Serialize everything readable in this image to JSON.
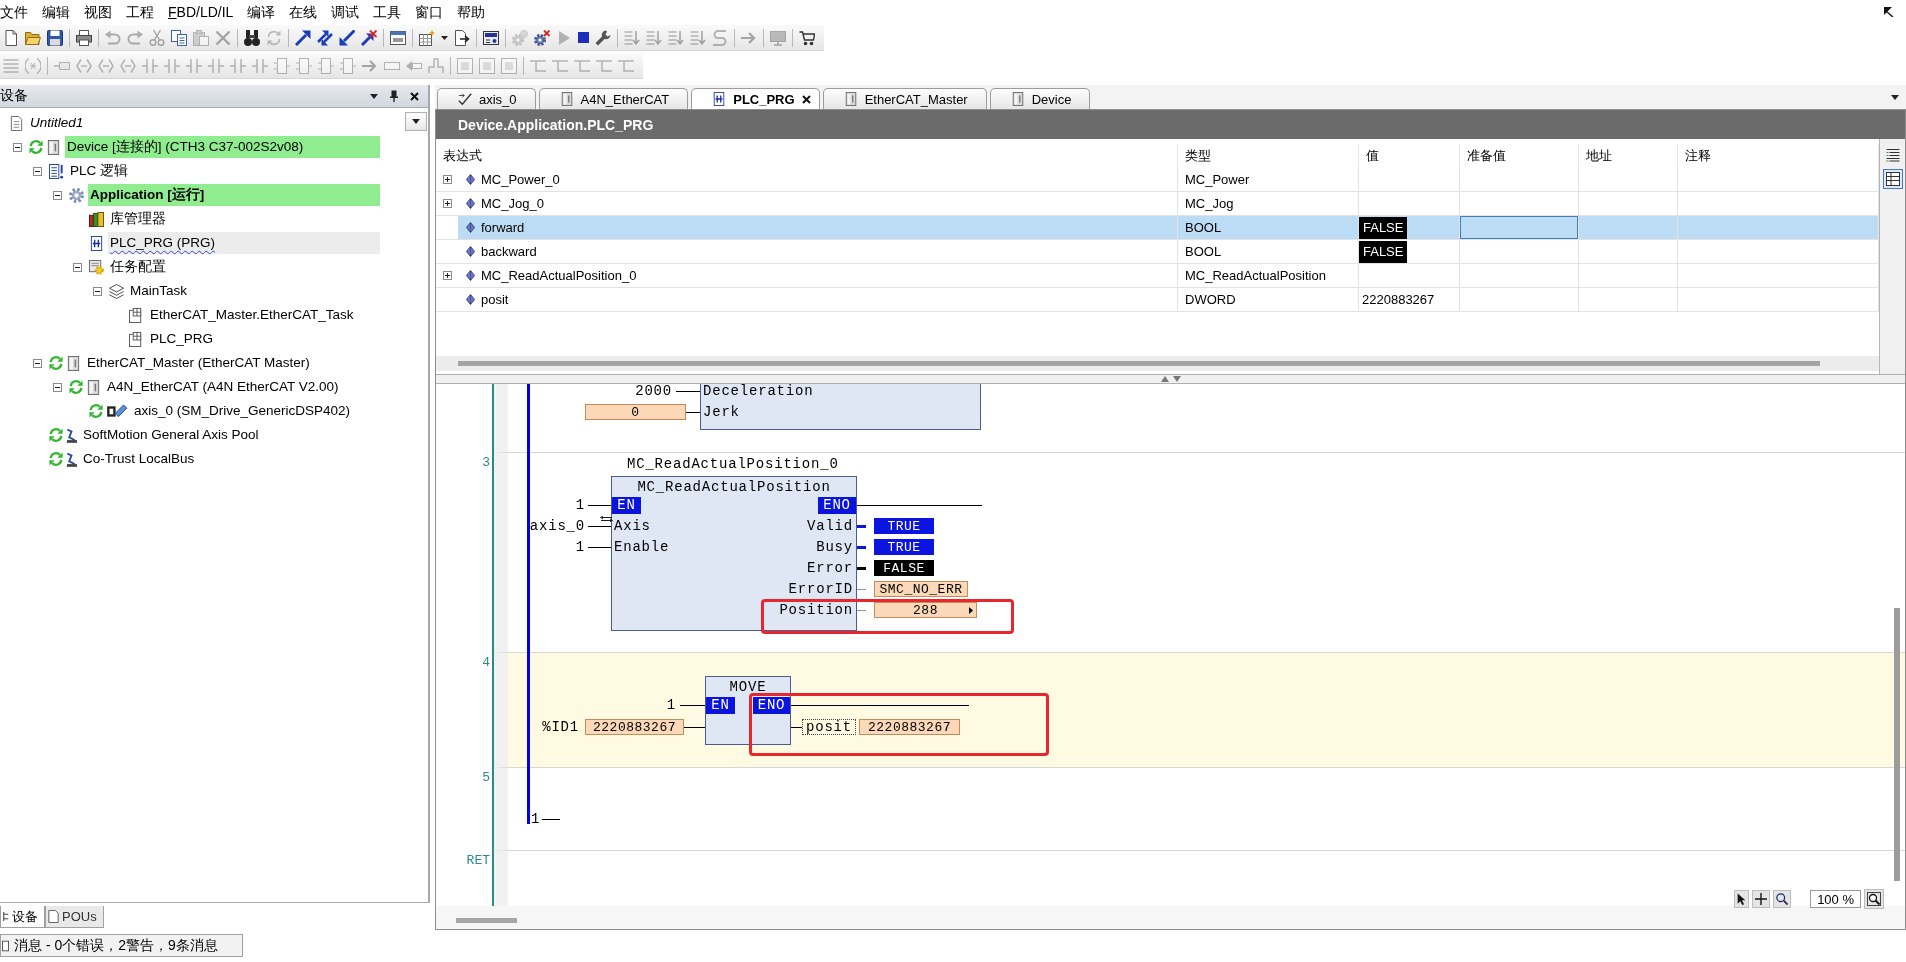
{
  "menu": [
    {
      "label": "文件",
      "mnemonic": false
    },
    {
      "label": "编辑",
      "mnemonic": false
    },
    {
      "label": "视图",
      "mnemonic": false
    },
    {
      "label": "工程",
      "mnemonic": false
    },
    {
      "label": "FBD/LD/IL",
      "mnemonic": true
    },
    {
      "label": "编译",
      "mnemonic": false
    },
    {
      "label": "在线",
      "mnemonic": false
    },
    {
      "label": "调试",
      "mnemonic": false
    },
    {
      "label": "工具",
      "mnemonic": false
    },
    {
      "label": "窗口",
      "mnemonic": false
    },
    {
      "label": "帮助",
      "mnemonic": false
    }
  ],
  "toolbar_main": [
    {
      "kind": "new",
      "disabled": false
    },
    {
      "kind": "open",
      "disabled": false
    },
    {
      "kind": "save",
      "disabled": false
    },
    {
      "kind": "separator"
    },
    {
      "kind": "print",
      "disabled": false
    },
    {
      "kind": "separator"
    },
    {
      "kind": "undo",
      "disabled": true
    },
    {
      "kind": "redo",
      "disabled": true
    },
    {
      "kind": "cut",
      "disabled": true
    },
    {
      "kind": "copy",
      "disabled": false
    },
    {
      "kind": "paste",
      "disabled": true
    },
    {
      "kind": "delete",
      "disabled": true
    },
    {
      "kind": "separator"
    },
    {
      "kind": "find",
      "disabled": false
    },
    {
      "kind": "replace",
      "disabled": true
    },
    {
      "kind": "separator"
    },
    {
      "kind": "login",
      "disabled": false
    },
    {
      "kind": "logout",
      "disabled": false
    },
    {
      "kind": "download",
      "disabled": false
    },
    {
      "kind": "reset",
      "disabled": false
    },
    {
      "kind": "separator"
    },
    {
      "kind": "window",
      "disabled": false
    },
    {
      "kind": "separator"
    },
    {
      "kind": "build",
      "disabled": false
    },
    {
      "kind": "caret",
      "disabled": false
    },
    {
      "kind": "export",
      "disabled": false
    },
    {
      "kind": "separator"
    },
    {
      "kind": "visualization",
      "disabled": false
    },
    {
      "kind": "separator"
    },
    {
      "kind": "start-gear",
      "disabled": true
    },
    {
      "kind": "stop-gear",
      "disabled": false
    },
    {
      "kind": "run",
      "disabled": true
    },
    {
      "kind": "stop",
      "disabled": false
    },
    {
      "kind": "wrench",
      "disabled": false
    },
    {
      "kind": "separator"
    },
    {
      "kind": "step",
      "disabled": true
    },
    {
      "kind": "step",
      "disabled": true
    },
    {
      "kind": "step",
      "disabled": true
    },
    {
      "kind": "step",
      "disabled": true
    },
    {
      "kind": "cycle",
      "disabled": true
    },
    {
      "kind": "separator"
    },
    {
      "kind": "arrow",
      "disabled": true
    },
    {
      "kind": "separator"
    },
    {
      "kind": "screen",
      "disabled": true
    },
    {
      "kind": "separator"
    },
    {
      "kind": "cart",
      "disabled": false
    }
  ],
  "toolbar_fbd": [
    {
      "kind": "list",
      "disabled": true
    },
    {
      "kind": "comment",
      "disabled": true
    },
    {
      "kind": "separator"
    },
    {
      "kind": "variable",
      "disabled": true
    },
    {
      "kind": "network",
      "disabled": true
    },
    {
      "kind": "network",
      "disabled": true
    },
    {
      "kind": "network",
      "disabled": true
    },
    {
      "kind": "contact",
      "disabled": true
    },
    {
      "kind": "contact",
      "disabled": true
    },
    {
      "kind": "contact",
      "disabled": true
    },
    {
      "kind": "contact",
      "disabled": true
    },
    {
      "kind": "contact",
      "disabled": true
    },
    {
      "kind": "contact",
      "disabled": true
    },
    {
      "kind": "box",
      "disabled": true
    },
    {
      "kind": "box",
      "disabled": true
    },
    {
      "kind": "box",
      "disabled": true
    },
    {
      "kind": "box",
      "disabled": true
    },
    {
      "kind": "arrow",
      "disabled": true
    },
    {
      "kind": "label",
      "disabled": true
    },
    {
      "kind": "return",
      "disabled": true
    },
    {
      "kind": "edge",
      "disabled": true
    },
    {
      "kind": "separator"
    },
    {
      "kind": "square",
      "disabled": true
    },
    {
      "kind": "square",
      "disabled": true
    },
    {
      "kind": "square",
      "disabled": true
    },
    {
      "kind": "separator"
    },
    {
      "kind": "branch",
      "disabled": true
    },
    {
      "kind": "branch",
      "disabled": true
    },
    {
      "kind": "branch",
      "disabled": true
    },
    {
      "kind": "branch",
      "disabled": true
    },
    {
      "kind": "branch",
      "disabled": true
    }
  ],
  "devices_panel": {
    "title": "设备",
    "tree": [
      {
        "label": "Untitled1",
        "kind": "project",
        "connected": false,
        "highlighted": false,
        "selected": false,
        "children": [
          {
            "label": "Device [连接的] (CTH3 C37-002S2v08)",
            "kind": "device",
            "expanded": true,
            "connected": true,
            "highlighted": true,
            "selected": false,
            "children": [
              {
                "label": "PLC 逻辑",
                "kind": "plc-logic",
                "expanded": true,
                "connected": false,
                "highlighted": false,
                "selected": false,
                "children": [
                  {
                    "label": "Application [运行]",
                    "kind": "application",
                    "expanded": true,
                    "connected": false,
                    "highlighted": true,
                    "selected": false,
                    "children": [
                      {
                        "label": "库管理器",
                        "kind": "library",
                        "connected": false,
                        "highlighted": false,
                        "selected": false
                      },
                      {
                        "label": "PLC_PRG (PRG)",
                        "kind": "pou",
                        "connected": false,
                        "highlighted": false,
                        "selected": true
                      },
                      {
                        "label": "任务配置",
                        "kind": "task-config",
                        "expanded": true,
                        "connected": false,
                        "highlighted": false,
                        "selected": false,
                        "children": [
                          {
                            "label": "MainTask",
                            "kind": "task",
                            "expanded": true,
                            "connected": false,
                            "highlighted": false,
                            "selected": false,
                            "children": [
                              {
                                "label": "EtherCAT_Master.EtherCAT_Task",
                                "kind": "task-call",
                                "connected": false,
                                "highlighted": false,
                                "selected": false
                              },
                              {
                                "label": "PLC_PRG",
                                "kind": "task-call",
                                "connected": false,
                                "highlighted": false,
                                "selected": false
                              }
                            ]
                          }
                        ]
                      }
                    ]
                  }
                ]
              },
              {
                "label": "EtherCAT_Master (EtherCAT Master)",
                "kind": "device",
                "expanded": true,
                "connected": true,
                "highlighted": false,
                "selected": false,
                "children": [
                  {
                    "label": "A4N_EtherCAT (A4N EtherCAT V2.00)",
                    "kind": "device",
                    "expanded": true,
                    "connected": true,
                    "highlighted": false,
                    "selected": false,
                    "children": [
                      {
                        "label": "axis_0 (SM_Drive_GenericDSP402)",
                        "kind": "axis",
                        "connected": true,
                        "highlighted": false,
                        "selected": false
                      }
                    ]
                  }
                ]
              },
              {
                "label": "SoftMotion General Axis Pool",
                "kind": "axis-pool",
                "connected": true,
                "highlighted": false,
                "selected": false
              },
              {
                "label": "Co-Trust LocalBus",
                "kind": "axis-pool",
                "connected": true,
                "highlighted": false,
                "selected": false
              }
            ]
          }
        ]
      }
    ],
    "tabs": [
      {
        "label": "设备",
        "selected": true
      },
      {
        "label": "POUs",
        "selected": false
      }
    ]
  },
  "editor": {
    "tabs": [
      {
        "label": "axis_0",
        "kind": "axis",
        "selected": false
      },
      {
        "label": "A4N_EtherCAT",
        "kind": "device",
        "selected": false
      },
      {
        "label": "PLC_PRG",
        "kind": "pou",
        "selected": true
      },
      {
        "label": "EtherCAT_Master",
        "kind": "device",
        "selected": false
      },
      {
        "label": "Device",
        "kind": "device",
        "selected": false
      }
    ],
    "path": "Device.Application.PLC_PRG",
    "watch": {
      "columns": [
        "表达式",
        "类型",
        "值",
        "准备值",
        "地址",
        "注释"
      ],
      "rows": [
        {
          "expression": "MC_Power_0",
          "type": "MC_Power",
          "kind": "instance",
          "expanded": false,
          "selected": false,
          "focused": false
        },
        {
          "expression": "MC_Jog_0",
          "type": "MC_Jog",
          "kind": "instance",
          "expanded": false,
          "selected": false,
          "focused": false
        },
        {
          "expression": "forward",
          "type": "BOOL",
          "value": "FALSE",
          "kind": "bool",
          "selected": true,
          "focused": true
        },
        {
          "expression": "backward",
          "type": "BOOL",
          "value": "FALSE",
          "kind": "bool",
          "selected": false,
          "focused": false
        },
        {
          "expression": "MC_ReadActualPosition_0",
          "type": "MC_ReadActualPosition",
          "kind": "instance",
          "expanded": false,
          "selected": false,
          "focused": false
        },
        {
          "expression": "posit",
          "type": "DWORD",
          "value": "2220883267",
          "kind": "number",
          "selected": false,
          "focused": false
        }
      ],
      "view_buttons": [
        {
          "kind": "list",
          "selected": false
        },
        {
          "kind": "table",
          "selected": true
        }
      ]
    },
    "fbd": {
      "networks": [
        {
          "kind": "block-tail",
          "selected": false,
          "inputs": [
            {
              "kind": "constant",
              "source": "2000",
              "pin": "Deceleration"
            },
            {
              "kind": "online",
              "source": "0",
              "pin": "Jerk"
            }
          ]
        },
        {
          "kind": "block",
          "number": "3",
          "selected": false,
          "instance": "MC_ReadActualPosition_0",
          "block": "MC_ReadActualPosition",
          "enable_in": {
            "source": "1",
            "pin": "EN"
          },
          "enable_out": {
            "pin": "ENO"
          },
          "inputs": [
            {
              "kind": "inout",
              "source": "axis_0",
              "pin": "Axis"
            },
            {
              "kind": "constant",
              "source": "1",
              "pin": "Enable"
            }
          ],
          "outputs": [
            {
              "pin": "Valid",
              "kind": "true",
              "value": "TRUE",
              "expandable": false,
              "annotated": false
            },
            {
              "pin": "Busy",
              "kind": "true",
              "value": "TRUE",
              "expandable": false,
              "annotated": false
            },
            {
              "pin": "Error",
              "kind": "false",
              "value": "FALSE",
              "expandable": false,
              "annotated": false
            },
            {
              "pin": "ErrorID",
              "kind": "online",
              "value": "SMC_NO_ERR",
              "expandable": false,
              "annotated": false
            },
            {
              "pin": "Position",
              "kind": "online",
              "value": "288",
              "expandable": true,
              "annotated": true
            }
          ]
        },
        {
          "kind": "move",
          "number": "4",
          "selected": true,
          "block": "MOVE",
          "enable_in": {
            "source": "1",
            "pin": "EN"
          },
          "enable_out": {
            "pin": "ENO"
          },
          "input": {
            "address": "%ID1",
            "value": "2220883267"
          },
          "output": {
            "variable": "posit",
            "value": "2220883267",
            "annotated": true
          }
        },
        {
          "kind": "empty",
          "number": "5",
          "selected": false,
          "source": "1"
        },
        {
          "kind": "return",
          "number": "RET",
          "selected": false
        }
      ]
    },
    "zoom": "100 %"
  },
  "status_bar": {
    "message": "消息 - 0个错误，2警告，9条消息"
  }
}
